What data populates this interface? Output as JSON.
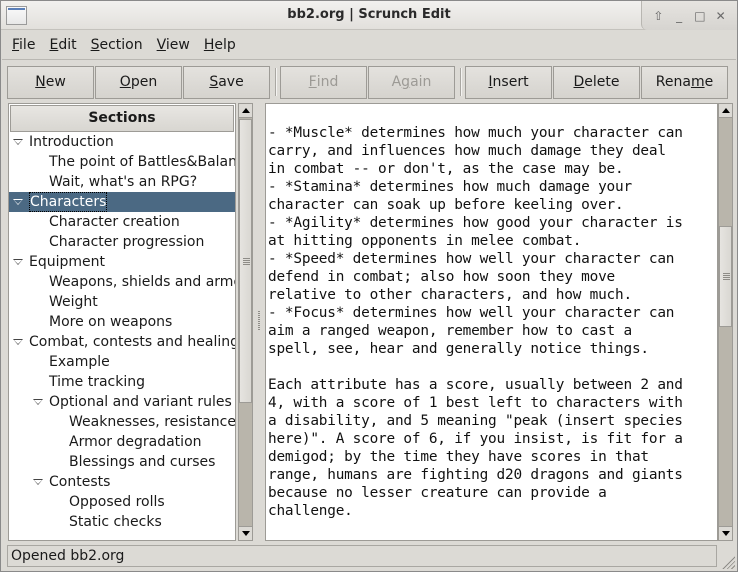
{
  "window": {
    "title": "bb2.org | Scrunch Edit",
    "controls": [
      {
        "name": "shade-button",
        "glyph": "⇧"
      },
      {
        "name": "minimize-button",
        "glyph": "_"
      },
      {
        "name": "maximize-button",
        "glyph": "□"
      },
      {
        "name": "close-button",
        "glyph": "✕"
      }
    ]
  },
  "menubar": {
    "items": [
      {
        "label": "File",
        "mnemonic": "F",
        "rest": "ile"
      },
      {
        "label": "Edit",
        "mnemonic": "E",
        "rest": "dit"
      },
      {
        "label": "Section",
        "mnemonic": "S",
        "rest": "ection"
      },
      {
        "label": "View",
        "mnemonic": "V",
        "rest": "iew"
      },
      {
        "label": "Help",
        "mnemonic": "H",
        "rest": "elp"
      }
    ]
  },
  "toolbar": {
    "new": {
      "pre": "",
      "mn": "N",
      "post": "ew"
    },
    "open": {
      "pre": "",
      "mn": "O",
      "post": "pen"
    },
    "save": {
      "pre": "",
      "mn": "S",
      "post": "ave"
    },
    "find": {
      "pre": "",
      "mn": "F",
      "post": "ind"
    },
    "again": {
      "pre": "A",
      "mn": "g",
      "post": "ain"
    },
    "insert": {
      "pre": "",
      "mn": "I",
      "post": "nsert"
    },
    "delete": {
      "pre": "",
      "mn": "D",
      "post": "elete"
    },
    "rename": {
      "pre": "Rena",
      "mn": "m",
      "post": "e"
    }
  },
  "sections": {
    "header": "Sections",
    "tree": [
      {
        "label": "Introduction",
        "level": 0,
        "expanded": true
      },
      {
        "label": "The point of Battles&Balance",
        "level": 1
      },
      {
        "label": "Wait, what's an RPG?",
        "level": 1
      },
      {
        "label": "Characters",
        "level": 0,
        "expanded": true,
        "selected": true
      },
      {
        "label": "Character creation",
        "level": 1
      },
      {
        "label": "Character progression",
        "level": 1
      },
      {
        "label": "Equipment",
        "level": 0,
        "expanded": true
      },
      {
        "label": "Weapons, shields and armor",
        "level": 1
      },
      {
        "label": "Weight",
        "level": 1
      },
      {
        "label": "More on weapons",
        "level": 1
      },
      {
        "label": "Combat, contests and healing",
        "level": 0,
        "expanded": true
      },
      {
        "label": "Example",
        "level": 1
      },
      {
        "label": "Time tracking",
        "level": 1
      },
      {
        "label": "Optional and variant rules",
        "level": 1,
        "expanded": true
      },
      {
        "label": "Weaknesses, resistances",
        "level": 2
      },
      {
        "label": "Armor degradation",
        "level": 2
      },
      {
        "label": "Blessings and curses",
        "level": 2
      },
      {
        "label": "Contests",
        "level": 1,
        "expanded": true
      },
      {
        "label": "Opposed rolls",
        "level": 2
      },
      {
        "label": "Static checks",
        "level": 2
      }
    ],
    "scroll_position_fraction": 0.0,
    "scroll_visible_fraction": 0.7
  },
  "editor": {
    "text": "\n- *Muscle* determines how much your character can\ncarry, and influences how much damage they deal\nin combat -- or don't, as the case may be.\n- *Stamina* determines how much damage your\ncharacter can soak up before keeling over.\n- *Agility* determines how good your character is\nat hitting opponents in melee combat.\n- *Speed* determines how well your character can\ndefend in combat; also how soon they move\nrelative to other characters, and how much.\n- *Focus* determines how well your character can\naim a ranged weapon, remember how to cast a\nspell, see, hear and generally notice things.\n\nEach attribute has a score, usually between 2 and\n4, with a score of 1 best left to characters with\na disability, and 5 meaning \"peak (insert species\nhere)\". A score of 6, if you insist, is fit for a\ndemigod; by the time they have scores in that\nrange, humans are fighting d20 dragons and giants\nbecause no lesser creature can provide a\nchallenge.",
    "scroll_position_fraction": 0.35,
    "scroll_visible_fraction": 0.25
  },
  "statusbar": {
    "text": "Opened bb2.org"
  },
  "colors": {
    "selection": "#4b6983",
    "window_bg": "#dcdad5"
  }
}
